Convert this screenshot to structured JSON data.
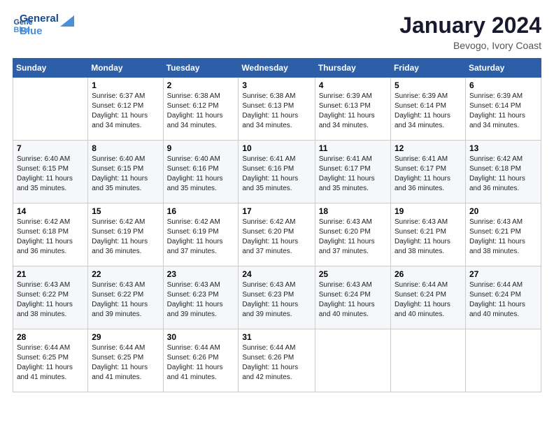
{
  "logo": {
    "line1": "General",
    "line2": "Blue"
  },
  "title": "January 2024",
  "location": "Bevogo, Ivory Coast",
  "weekdays": [
    "Sunday",
    "Monday",
    "Tuesday",
    "Wednesday",
    "Thursday",
    "Friday",
    "Saturday"
  ],
  "weeks": [
    [
      {
        "day": "",
        "sunrise": "",
        "sunset": "",
        "daylight": ""
      },
      {
        "day": "1",
        "sunrise": "Sunrise: 6:37 AM",
        "sunset": "Sunset: 6:12 PM",
        "daylight": "Daylight: 11 hours and 34 minutes."
      },
      {
        "day": "2",
        "sunrise": "Sunrise: 6:38 AM",
        "sunset": "Sunset: 6:12 PM",
        "daylight": "Daylight: 11 hours and 34 minutes."
      },
      {
        "day": "3",
        "sunrise": "Sunrise: 6:38 AM",
        "sunset": "Sunset: 6:13 PM",
        "daylight": "Daylight: 11 hours and 34 minutes."
      },
      {
        "day": "4",
        "sunrise": "Sunrise: 6:39 AM",
        "sunset": "Sunset: 6:13 PM",
        "daylight": "Daylight: 11 hours and 34 minutes."
      },
      {
        "day": "5",
        "sunrise": "Sunrise: 6:39 AM",
        "sunset": "Sunset: 6:14 PM",
        "daylight": "Daylight: 11 hours and 34 minutes."
      },
      {
        "day": "6",
        "sunrise": "Sunrise: 6:39 AM",
        "sunset": "Sunset: 6:14 PM",
        "daylight": "Daylight: 11 hours and 34 minutes."
      }
    ],
    [
      {
        "day": "7",
        "sunrise": "Sunrise: 6:40 AM",
        "sunset": "Sunset: 6:15 PM",
        "daylight": "Daylight: 11 hours and 35 minutes."
      },
      {
        "day": "8",
        "sunrise": "Sunrise: 6:40 AM",
        "sunset": "Sunset: 6:15 PM",
        "daylight": "Daylight: 11 hours and 35 minutes."
      },
      {
        "day": "9",
        "sunrise": "Sunrise: 6:40 AM",
        "sunset": "Sunset: 6:16 PM",
        "daylight": "Daylight: 11 hours and 35 minutes."
      },
      {
        "day": "10",
        "sunrise": "Sunrise: 6:41 AM",
        "sunset": "Sunset: 6:16 PM",
        "daylight": "Daylight: 11 hours and 35 minutes."
      },
      {
        "day": "11",
        "sunrise": "Sunrise: 6:41 AM",
        "sunset": "Sunset: 6:17 PM",
        "daylight": "Daylight: 11 hours and 35 minutes."
      },
      {
        "day": "12",
        "sunrise": "Sunrise: 6:41 AM",
        "sunset": "Sunset: 6:17 PM",
        "daylight": "Daylight: 11 hours and 36 minutes."
      },
      {
        "day": "13",
        "sunrise": "Sunrise: 6:42 AM",
        "sunset": "Sunset: 6:18 PM",
        "daylight": "Daylight: 11 hours and 36 minutes."
      }
    ],
    [
      {
        "day": "14",
        "sunrise": "Sunrise: 6:42 AM",
        "sunset": "Sunset: 6:18 PM",
        "daylight": "Daylight: 11 hours and 36 minutes."
      },
      {
        "day": "15",
        "sunrise": "Sunrise: 6:42 AM",
        "sunset": "Sunset: 6:19 PM",
        "daylight": "Daylight: 11 hours and 36 minutes."
      },
      {
        "day": "16",
        "sunrise": "Sunrise: 6:42 AM",
        "sunset": "Sunset: 6:19 PM",
        "daylight": "Daylight: 11 hours and 37 minutes."
      },
      {
        "day": "17",
        "sunrise": "Sunrise: 6:42 AM",
        "sunset": "Sunset: 6:20 PM",
        "daylight": "Daylight: 11 hours and 37 minutes."
      },
      {
        "day": "18",
        "sunrise": "Sunrise: 6:43 AM",
        "sunset": "Sunset: 6:20 PM",
        "daylight": "Daylight: 11 hours and 37 minutes."
      },
      {
        "day": "19",
        "sunrise": "Sunrise: 6:43 AM",
        "sunset": "Sunset: 6:21 PM",
        "daylight": "Daylight: 11 hours and 38 minutes."
      },
      {
        "day": "20",
        "sunrise": "Sunrise: 6:43 AM",
        "sunset": "Sunset: 6:21 PM",
        "daylight": "Daylight: 11 hours and 38 minutes."
      }
    ],
    [
      {
        "day": "21",
        "sunrise": "Sunrise: 6:43 AM",
        "sunset": "Sunset: 6:22 PM",
        "daylight": "Daylight: 11 hours and 38 minutes."
      },
      {
        "day": "22",
        "sunrise": "Sunrise: 6:43 AM",
        "sunset": "Sunset: 6:22 PM",
        "daylight": "Daylight: 11 hours and 39 minutes."
      },
      {
        "day": "23",
        "sunrise": "Sunrise: 6:43 AM",
        "sunset": "Sunset: 6:23 PM",
        "daylight": "Daylight: 11 hours and 39 minutes."
      },
      {
        "day": "24",
        "sunrise": "Sunrise: 6:43 AM",
        "sunset": "Sunset: 6:23 PM",
        "daylight": "Daylight: 11 hours and 39 minutes."
      },
      {
        "day": "25",
        "sunrise": "Sunrise: 6:43 AM",
        "sunset": "Sunset: 6:24 PM",
        "daylight": "Daylight: 11 hours and 40 minutes."
      },
      {
        "day": "26",
        "sunrise": "Sunrise: 6:44 AM",
        "sunset": "Sunset: 6:24 PM",
        "daylight": "Daylight: 11 hours and 40 minutes."
      },
      {
        "day": "27",
        "sunrise": "Sunrise: 6:44 AM",
        "sunset": "Sunset: 6:24 PM",
        "daylight": "Daylight: 11 hours and 40 minutes."
      }
    ],
    [
      {
        "day": "28",
        "sunrise": "Sunrise: 6:44 AM",
        "sunset": "Sunset: 6:25 PM",
        "daylight": "Daylight: 11 hours and 41 minutes."
      },
      {
        "day": "29",
        "sunrise": "Sunrise: 6:44 AM",
        "sunset": "Sunset: 6:25 PM",
        "daylight": "Daylight: 11 hours and 41 minutes."
      },
      {
        "day": "30",
        "sunrise": "Sunrise: 6:44 AM",
        "sunset": "Sunset: 6:26 PM",
        "daylight": "Daylight: 11 hours and 41 minutes."
      },
      {
        "day": "31",
        "sunrise": "Sunrise: 6:44 AM",
        "sunset": "Sunset: 6:26 PM",
        "daylight": "Daylight: 11 hours and 42 minutes."
      },
      {
        "day": "",
        "sunrise": "",
        "sunset": "",
        "daylight": ""
      },
      {
        "day": "",
        "sunrise": "",
        "sunset": "",
        "daylight": ""
      },
      {
        "day": "",
        "sunrise": "",
        "sunset": "",
        "daylight": ""
      }
    ]
  ]
}
